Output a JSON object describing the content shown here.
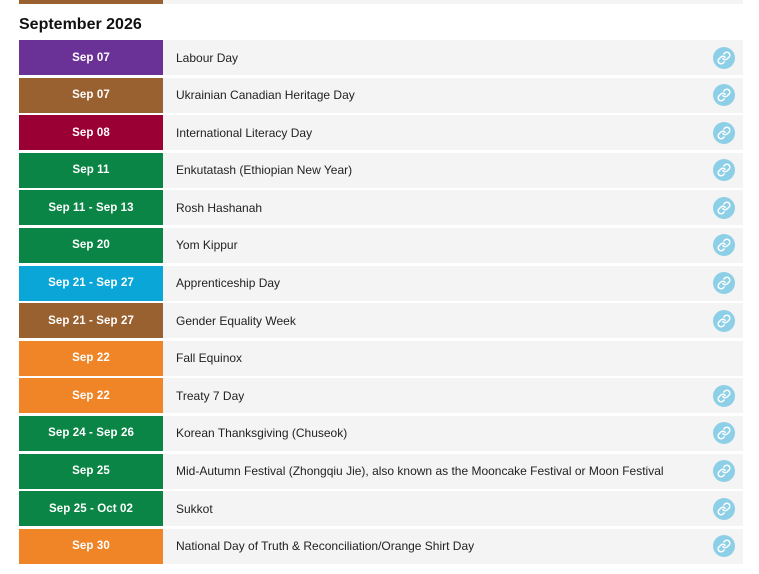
{
  "month_heading": "September 2026",
  "colors": {
    "purple": "#6a3196",
    "brown": "#9a6130",
    "crimson": "#9b0035",
    "green": "#0b8545",
    "blue": "#0aa6d8",
    "orange": "#ef8527",
    "link_icon_bg": "#8ccfe6",
    "row_bg": "#f4f4f4"
  },
  "events": [
    {
      "date": "Sep 07",
      "title": "Labour Day",
      "color": "#6a3196",
      "has_link": true
    },
    {
      "date": "Sep 07",
      "title": "Ukrainian Canadian Heritage Day",
      "color": "#9a6130",
      "has_link": true
    },
    {
      "date": "Sep 08",
      "title": "International Literacy Day",
      "color": "#9b0035",
      "has_link": true
    },
    {
      "date": "Sep 11",
      "title": "Enkutatash (Ethiopian New Year)",
      "color": "#0b8545",
      "has_link": true
    },
    {
      "date": "Sep 11 - Sep 13",
      "title": "Rosh Hashanah",
      "color": "#0b8545",
      "has_link": true
    },
    {
      "date": "Sep 20",
      "title": "Yom Kippur",
      "color": "#0b8545",
      "has_link": true
    },
    {
      "date": "Sep 21 - Sep 27",
      "title": "Apprenticeship Day",
      "color": "#0aa6d8",
      "has_link": true
    },
    {
      "date": "Sep 21 - Sep 27",
      "title": "Gender Equality Week",
      "color": "#9a6130",
      "has_link": true
    },
    {
      "date": "Sep 22",
      "title": "Fall Equinox",
      "color": "#ef8527",
      "has_link": false
    },
    {
      "date": "Sep 22",
      "title": "Treaty 7 Day",
      "color": "#ef8527",
      "has_link": true
    },
    {
      "date": "Sep 24 - Sep 26",
      "title": "Korean Thanksgiving (Chuseok)",
      "color": "#0b8545",
      "has_link": true
    },
    {
      "date": "Sep 25",
      "title": "Mid-Autumn Festival (Zhongqiu Jie), also known as the Mooncake Festival or Moon Festival",
      "color": "#0b8545",
      "has_link": true
    },
    {
      "date": "Sep 25 - Oct 02",
      "title": "Sukkot",
      "color": "#0b8545",
      "has_link": true
    },
    {
      "date": "Sep 30",
      "title": "National Day of Truth & Reconciliation/Orange Shirt Day",
      "color": "#ef8527",
      "has_link": true
    }
  ]
}
